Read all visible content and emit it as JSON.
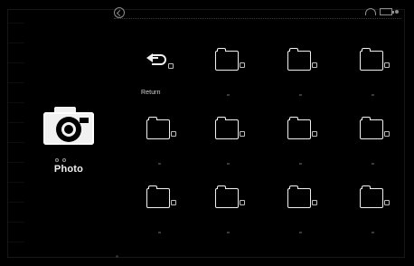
{
  "app": {
    "section_label": "Photo"
  },
  "grid": {
    "items": [
      {
        "type": "return",
        "label": "Return"
      },
      {
        "type": "folder",
        "label": ""
      },
      {
        "type": "folder",
        "label": ""
      },
      {
        "type": "folder",
        "label": ""
      },
      {
        "type": "folder",
        "label": ""
      },
      {
        "type": "folder",
        "label": ""
      },
      {
        "type": "folder",
        "label": ""
      },
      {
        "type": "folder",
        "label": ""
      },
      {
        "type": "folder",
        "label": ""
      },
      {
        "type": "folder",
        "label": ""
      },
      {
        "type": "folder",
        "label": ""
      },
      {
        "type": "folder",
        "label": ""
      }
    ]
  },
  "icons": {
    "top": "back-icon",
    "section": "camera-icon",
    "return": "return-icon",
    "folder": "folder-icon",
    "status_wifi": "wifi-icon",
    "status_battery": "battery-icon"
  }
}
